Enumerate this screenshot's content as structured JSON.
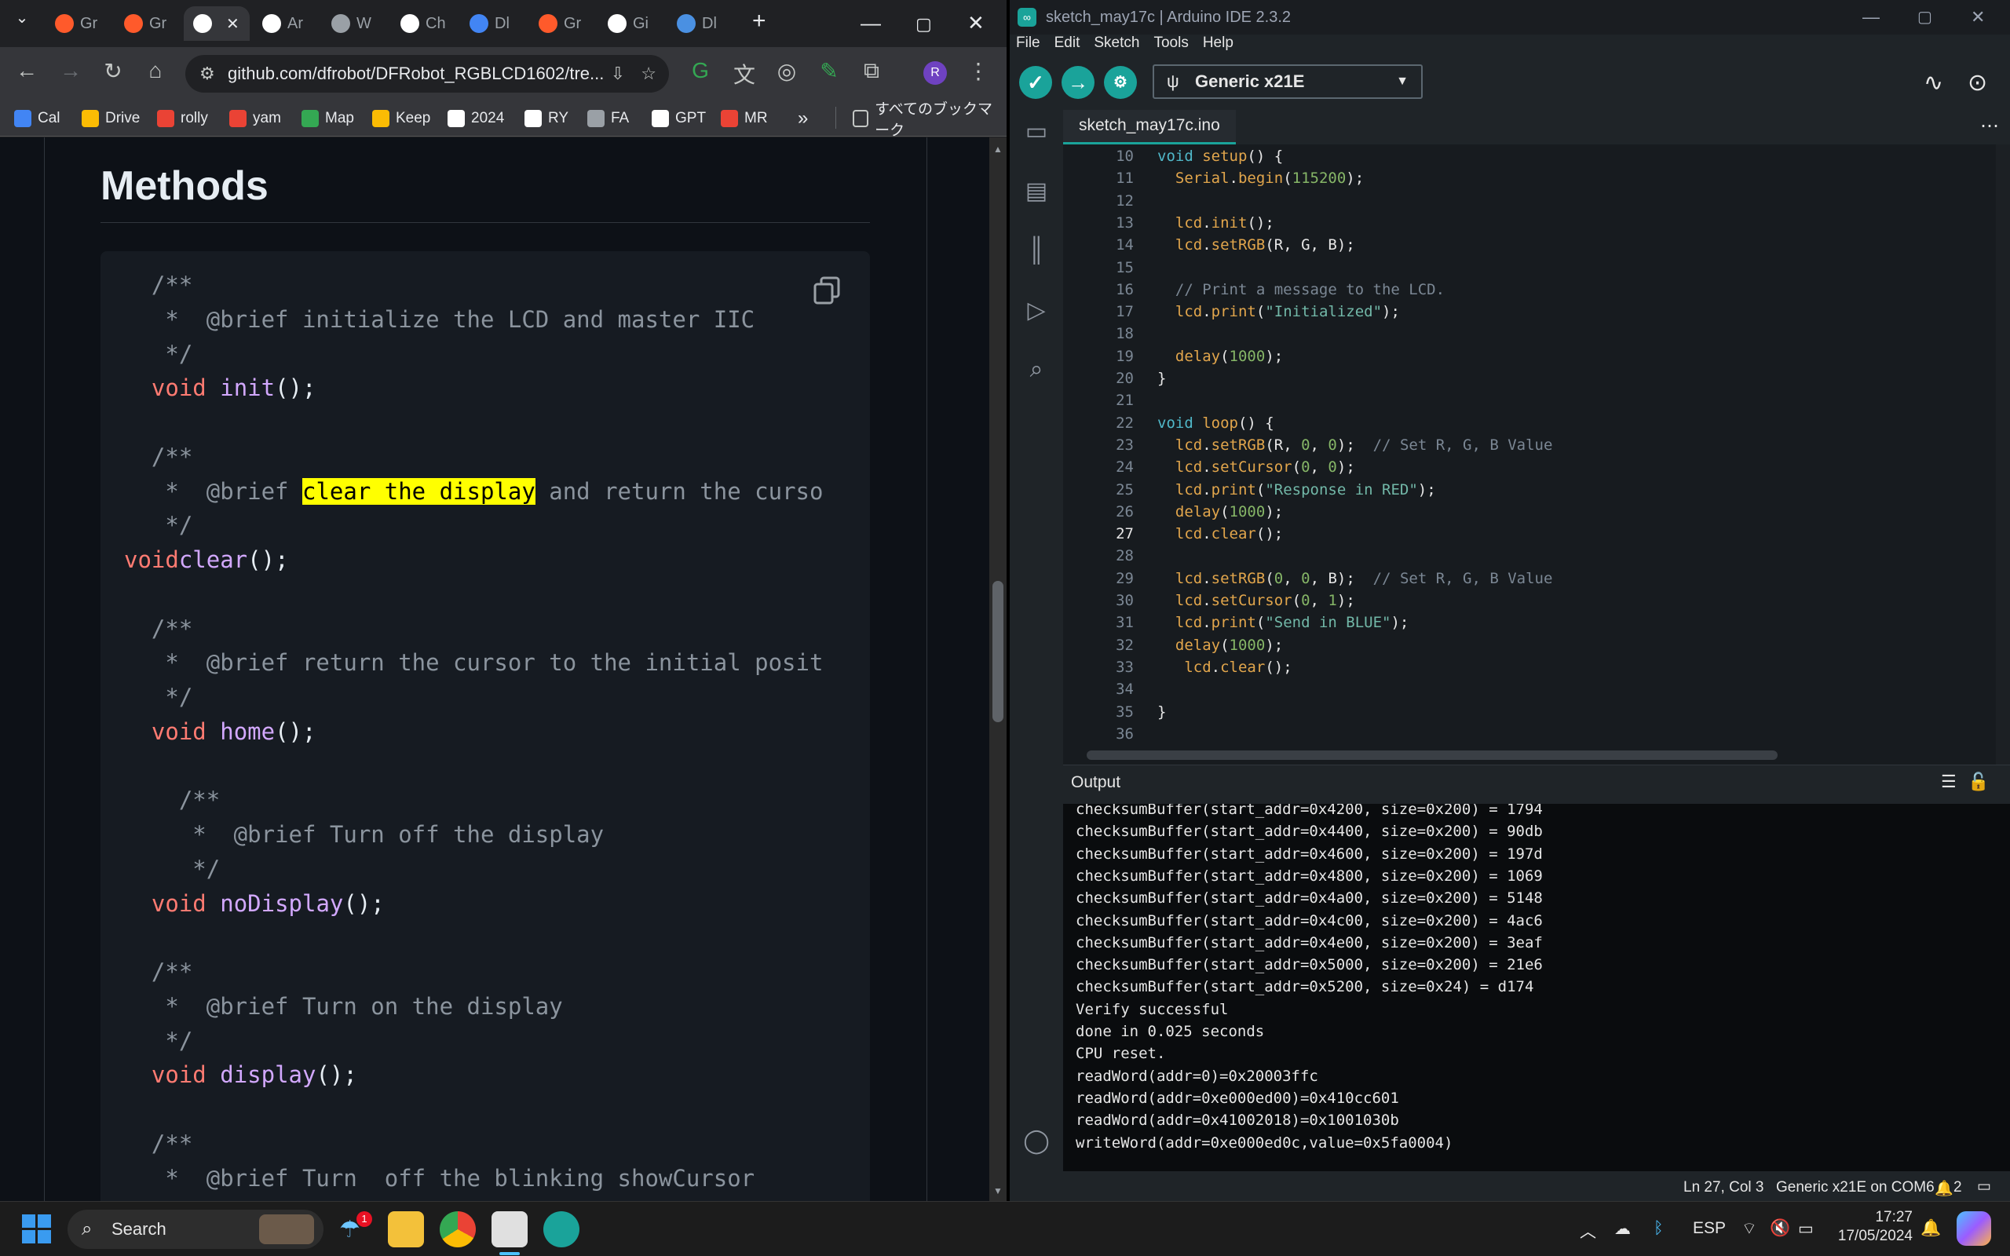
{
  "chrome": {
    "tabs": [
      {
        "label": "Gr",
        "color": "#ff5a2b"
      },
      {
        "label": "Gr",
        "color": "#ff5a2b"
      },
      {
        "label": "",
        "color": "#ffffff"
      },
      {
        "label": "Ar",
        "color": "#ffffff"
      },
      {
        "label": "W",
        "color": "#9aa0a6"
      },
      {
        "label": "Ch",
        "color": "#ffffff"
      },
      {
        "label": "Dl",
        "color": "#4285f4"
      },
      {
        "label": "Gr",
        "color": "#ff5a2b"
      },
      {
        "label": "Gi",
        "color": "#ffffff"
      },
      {
        "label": "Dl",
        "color": "#4a90e2"
      }
    ],
    "url": "github.com/dfrobot/DFRobot_RGBLCD1602/tre...",
    "profile_initial": "R",
    "bookmarks": [
      {
        "label": "Cal",
        "color": "#4285f4"
      },
      {
        "label": "Drive",
        "color": "#fbbc04"
      },
      {
        "label": "rolly",
        "color": "#ea4335"
      },
      {
        "label": "yam",
        "color": "#ea4335"
      },
      {
        "label": "Map",
        "color": "#34a853"
      },
      {
        "label": "Keep",
        "color": "#fbbc04"
      },
      {
        "label": "2024",
        "color": "#ffffff"
      },
      {
        "label": "RY",
        "color": "#ffffff"
      },
      {
        "label": "FA",
        "color": "#9aa0a6"
      },
      {
        "label": "GPT",
        "color": "#ffffff"
      },
      {
        "label": "MR",
        "color": "#ea4335"
      }
    ],
    "bookmarks_overflow": "»",
    "all_bookmarks": "すべてのブックマーク",
    "page": {
      "heading": "Methods",
      "code": [
        {
          "t": "/**",
          "cls": "cm",
          "indent": "  "
        },
        {
          "t": " *  @brief initialize the LCD and master IIC",
          "cls": "cm",
          "indent": "  "
        },
        {
          "t": " */",
          "cls": "cm",
          "indent": "  "
        },
        {
          "kw": "void",
          "fn": "init",
          "rest": "();",
          "indent": "  "
        },
        {
          "t": "",
          "cls": "cm",
          "indent": ""
        },
        {
          "t": "/**",
          "cls": "cm",
          "indent": "  "
        },
        {
          "pre": " *  @brief ",
          "hl": "clear the display",
          "post": " and return the curso",
          "indent": "  "
        },
        {
          "t": " */",
          "cls": "cm",
          "indent": "  "
        },
        {
          "kw": "void",
          "fn": "clear",
          "rest": "();",
          "indent": "",
          "nospace": true
        },
        {
          "t": "",
          "cls": "cm",
          "indent": ""
        },
        {
          "t": "/**",
          "cls": "cm",
          "indent": "  "
        },
        {
          "t": " *  @brief return the cursor to the initial posit",
          "cls": "cm",
          "indent": "  "
        },
        {
          "t": " */",
          "cls": "cm",
          "indent": "  "
        },
        {
          "kw": "void",
          "fn": "home",
          "rest": "();",
          "indent": "  "
        },
        {
          "t": "",
          "cls": "cm",
          "indent": ""
        },
        {
          "t": "/**",
          "cls": "cm",
          "indent": "    "
        },
        {
          "t": " *  @brief Turn off the display",
          "cls": "cm",
          "indent": "    "
        },
        {
          "t": " */",
          "cls": "cm",
          "indent": "    "
        },
        {
          "kw": "void",
          "fn": "noDisplay",
          "rest": "();",
          "indent": "  "
        },
        {
          "t": "",
          "cls": "cm",
          "indent": ""
        },
        {
          "t": "/**",
          "cls": "cm",
          "indent": "  "
        },
        {
          "t": " *  @brief Turn on the display",
          "cls": "cm",
          "indent": "  "
        },
        {
          "t": " */",
          "cls": "cm",
          "indent": "  "
        },
        {
          "kw": "void",
          "fn": "display",
          "rest": "();",
          "indent": "  "
        },
        {
          "t": "",
          "cls": "cm",
          "indent": ""
        },
        {
          "t": "/**",
          "cls": "cm",
          "indent": "  "
        },
        {
          "t": " *  @brief Turn  off the blinking showCursor",
          "cls": "cm",
          "indent": "  "
        }
      ]
    }
  },
  "arduino": {
    "title": "sketch_may17c | Arduino IDE 2.3.2",
    "menu": [
      "File",
      "Edit",
      "Sketch",
      "Tools",
      "Help"
    ],
    "board": "Generic x21E",
    "file_tab": "sketch_may17c.ino",
    "lines": [
      {
        "n": "10",
        "code": [
          [
            "ak",
            "void "
          ],
          [
            "af",
            "setup"
          ],
          [
            "",
            "() {"
          ]
        ]
      },
      {
        "n": "11",
        "code": [
          [
            "",
            "  "
          ],
          [
            "af",
            "Serial"
          ],
          [
            "",
            "."
          ],
          [
            "af",
            "begin"
          ],
          [
            "",
            "("
          ],
          [
            "an",
            "115200"
          ],
          [
            "",
            ");"
          ]
        ]
      },
      {
        "n": "12",
        "code": []
      },
      {
        "n": "13",
        "code": [
          [
            "",
            "  "
          ],
          [
            "af",
            "lcd"
          ],
          [
            "",
            "."
          ],
          [
            "af",
            "init"
          ],
          [
            "",
            "();"
          ]
        ]
      },
      {
        "n": "14",
        "code": [
          [
            "",
            "  "
          ],
          [
            "af",
            "lcd"
          ],
          [
            "",
            "."
          ],
          [
            "af",
            "setRGB"
          ],
          [
            "",
            "(R, G, B);"
          ]
        ]
      },
      {
        "n": "15",
        "code": []
      },
      {
        "n": "16",
        "code": [
          [
            "ac",
            "  // Print a message to the LCD."
          ]
        ]
      },
      {
        "n": "17",
        "code": [
          [
            "",
            "  "
          ],
          [
            "af",
            "lcd"
          ],
          [
            "",
            "."
          ],
          [
            "af",
            "print"
          ],
          [
            "",
            "("
          ],
          [
            "as",
            "\"Initialized\""
          ],
          [
            "",
            ");"
          ]
        ]
      },
      {
        "n": "18",
        "code": []
      },
      {
        "n": "19",
        "code": [
          [
            "",
            "  "
          ],
          [
            "af",
            "delay"
          ],
          [
            "",
            "("
          ],
          [
            "an",
            "1000"
          ],
          [
            "",
            ");"
          ]
        ]
      },
      {
        "n": "20",
        "code": [
          [
            "",
            "}"
          ]
        ]
      },
      {
        "n": "21",
        "code": []
      },
      {
        "n": "22",
        "code": [
          [
            "ak",
            "void "
          ],
          [
            "af",
            "loop"
          ],
          [
            "",
            "() {"
          ]
        ]
      },
      {
        "n": "23",
        "code": [
          [
            "",
            "  "
          ],
          [
            "af",
            "lcd"
          ],
          [
            "",
            "."
          ],
          [
            "af",
            "setRGB"
          ],
          [
            "",
            "(R, "
          ],
          [
            "an",
            "0"
          ],
          [
            "",
            ", "
          ],
          [
            "an",
            "0"
          ],
          [
            "",
            ");  "
          ],
          [
            "ac",
            "// Set R, G, B Value"
          ]
        ]
      },
      {
        "n": "24",
        "code": [
          [
            "",
            "  "
          ],
          [
            "af",
            "lcd"
          ],
          [
            "",
            "."
          ],
          [
            "af",
            "setCursor"
          ],
          [
            "",
            "("
          ],
          [
            "an",
            "0"
          ],
          [
            "",
            ", "
          ],
          [
            "an",
            "0"
          ],
          [
            "",
            ");"
          ]
        ]
      },
      {
        "n": "25",
        "code": [
          [
            "",
            "  "
          ],
          [
            "af",
            "lcd"
          ],
          [
            "",
            "."
          ],
          [
            "af",
            "print"
          ],
          [
            "",
            "("
          ],
          [
            "as",
            "\"Response in RED\""
          ],
          [
            "",
            ");"
          ]
        ]
      },
      {
        "n": "26",
        "code": [
          [
            "",
            "  "
          ],
          [
            "af",
            "delay"
          ],
          [
            "",
            "("
          ],
          [
            "an",
            "1000"
          ],
          [
            "",
            ");"
          ]
        ]
      },
      {
        "n": "27",
        "code": [
          [
            "",
            "  "
          ],
          [
            "af",
            "lcd"
          ],
          [
            "",
            "."
          ],
          [
            "af",
            "clear"
          ],
          [
            "",
            "();"
          ]
        ]
      },
      {
        "n": "28",
        "code": []
      },
      {
        "n": "29",
        "code": [
          [
            "",
            "  "
          ],
          [
            "af",
            "lcd"
          ],
          [
            "",
            "."
          ],
          [
            "af",
            "setRGB"
          ],
          [
            "",
            "("
          ],
          [
            "an",
            "0"
          ],
          [
            "",
            ", "
          ],
          [
            "an",
            "0"
          ],
          [
            "",
            ", B);  "
          ],
          [
            "ac",
            "// Set R, G, B Value"
          ]
        ]
      },
      {
        "n": "30",
        "code": [
          [
            "",
            "  "
          ],
          [
            "af",
            "lcd"
          ],
          [
            "",
            "."
          ],
          [
            "af",
            "setCursor"
          ],
          [
            "",
            "("
          ],
          [
            "an",
            "0"
          ],
          [
            "",
            ", "
          ],
          [
            "an",
            "1"
          ],
          [
            "",
            ");"
          ]
        ]
      },
      {
        "n": "31",
        "code": [
          [
            "",
            "  "
          ],
          [
            "af",
            "lcd"
          ],
          [
            "",
            "."
          ],
          [
            "af",
            "print"
          ],
          [
            "",
            "("
          ],
          [
            "as",
            "\"Send in BLUE\""
          ],
          [
            "",
            ");"
          ]
        ]
      },
      {
        "n": "32",
        "code": [
          [
            "",
            "  "
          ],
          [
            "af",
            "delay"
          ],
          [
            "",
            "("
          ],
          [
            "an",
            "1000"
          ],
          [
            "",
            ");"
          ]
        ]
      },
      {
        "n": "33",
        "code": [
          [
            "",
            "   "
          ],
          [
            "af",
            "lcd"
          ],
          [
            "",
            "."
          ],
          [
            "af",
            "clear"
          ],
          [
            "",
            "();"
          ]
        ]
      },
      {
        "n": "34",
        "code": []
      },
      {
        "n": "35",
        "code": [
          [
            "",
            "}"
          ]
        ]
      },
      {
        "n": "36",
        "code": []
      }
    ],
    "output_label": "Output",
    "output": [
      "checksumBuffer(start_addr=0x4200, size=0x200) = 1794",
      "checksumBuffer(start_addr=0x4400, size=0x200) = 90db",
      "checksumBuffer(start_addr=0x4600, size=0x200) = 197d",
      "checksumBuffer(start_addr=0x4800, size=0x200) = 1069",
      "checksumBuffer(start_addr=0x4a00, size=0x200) = 5148",
      "checksumBuffer(start_addr=0x4c00, size=0x200) = 4ac6",
      "checksumBuffer(start_addr=0x4e00, size=0x200) = 3eaf",
      "checksumBuffer(start_addr=0x5000, size=0x200) = 21e6",
      "checksumBuffer(start_addr=0x5200, size=0x24) = d174",
      "Verify successful",
      "done in 0.025 seconds",
      "CPU reset.",
      "readWord(addr=0)=0x20003ffc",
      "readWord(addr=0xe000ed00)=0x410cc601",
      "readWord(addr=0x41002018)=0x1001030b",
      "writeWord(addr=0xe000ed0c,value=0x5fa0004)"
    ],
    "status": {
      "cursor": "Ln 27, Col 3",
      "port": "Generic x21E on COM6",
      "notifications": "2"
    }
  },
  "taskbar": {
    "search": "Search",
    "weather_badge": "1",
    "lang": "ESP",
    "time": "17:27",
    "date": "17/05/2024"
  }
}
